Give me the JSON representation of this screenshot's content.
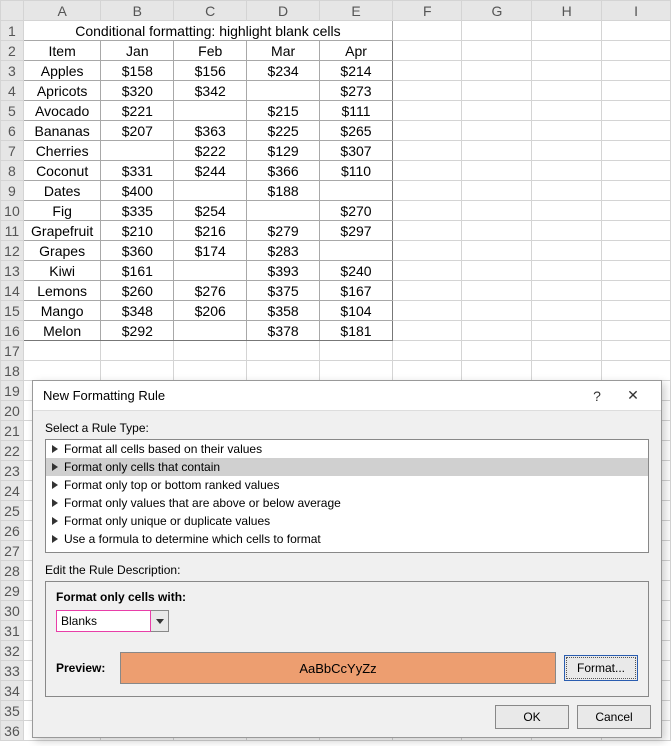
{
  "title": "Conditional formatting: highlight blank cells",
  "columns": [
    "",
    "A",
    "B",
    "C",
    "D",
    "E",
    "F",
    "G",
    "H",
    "I"
  ],
  "headers": {
    "item": "Item",
    "jan": "Jan",
    "feb": "Feb",
    "mar": "Mar",
    "apr": "Apr"
  },
  "rows": [
    {
      "item": "Apples",
      "jan": "$158",
      "feb": "$156",
      "mar": "$234",
      "apr": "$214"
    },
    {
      "item": "Apricots",
      "jan": "$320",
      "feb": "$342",
      "mar": "",
      "apr": "$273"
    },
    {
      "item": "Avocado",
      "jan": "$221",
      "feb": "",
      "mar": "$215",
      "apr": "$111"
    },
    {
      "item": "Bananas",
      "jan": "$207",
      "feb": "$363",
      "mar": "$225",
      "apr": "$265"
    },
    {
      "item": "Cherries",
      "jan": "",
      "feb": "$222",
      "mar": "$129",
      "apr": "$307"
    },
    {
      "item": "Coconut",
      "jan": "$331",
      "feb": "$244",
      "mar": "$366",
      "apr": "$110"
    },
    {
      "item": "Dates",
      "jan": "$400",
      "feb": "",
      "mar": "$188",
      "apr": ""
    },
    {
      "item": "Fig",
      "jan": "$335",
      "feb": "$254",
      "mar": "",
      "apr": "$270"
    },
    {
      "item": "Grapefruit",
      "jan": "$210",
      "feb": "$216",
      "mar": "$279",
      "apr": "$297"
    },
    {
      "item": "Grapes",
      "jan": "$360",
      "feb": "$174",
      "mar": "$283",
      "apr": ""
    },
    {
      "item": "Kiwi",
      "jan": "$161",
      "feb": "",
      "mar": "$393",
      "apr": "$240"
    },
    {
      "item": "Lemons",
      "jan": "$260",
      "feb": "$276",
      "mar": "$375",
      "apr": "$167"
    },
    {
      "item": "Mango",
      "jan": "$348",
      "feb": "$206",
      "mar": "$358",
      "apr": "$104"
    },
    {
      "item": "Melon",
      "jan": "$292",
      "feb": "",
      "mar": "$378",
      "apr": "$181"
    }
  ],
  "dialog": {
    "title": "New Formatting Rule",
    "help": "?",
    "close": "✕",
    "select_rule_label": "Select a Rule Type:",
    "rule_types": [
      "Format all cells based on their values",
      "Format only cells that contain",
      "Format only top or bottom ranked values",
      "Format only values that are above or below average",
      "Format only unique or duplicate values",
      "Use a formula to determine which cells to format"
    ],
    "selected_rule_index": 1,
    "edit_desc_label": "Edit the Rule Description:",
    "format_only_label": "Format only cells with:",
    "combo_value": "Blanks",
    "preview_label": "Preview:",
    "preview_text": "AaBbCcYyZz",
    "format_btn": "Format...",
    "ok": "OK",
    "cancel": "Cancel"
  }
}
